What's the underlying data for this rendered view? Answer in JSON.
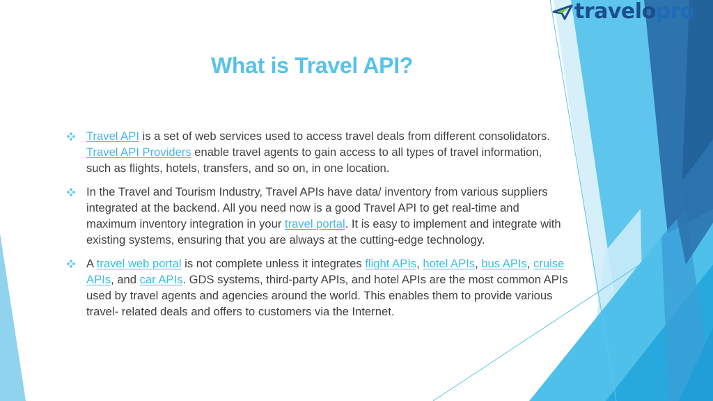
{
  "brand": {
    "logo_text_main": "travelo",
    "logo_text_accent": "pro",
    "colors": {
      "logo_dark": "#1a4e8c",
      "logo_green": "#7ac142",
      "title": "#56c3ea",
      "link": "#45b9e0",
      "body_text": "#404040",
      "shape_light": "#8fd3ef",
      "shape_mid": "#56c3ea",
      "shape_bright": "#2bb0e0",
      "shape_dark": "#2a6aa3",
      "shape_navy": "#23639b"
    }
  },
  "slide": {
    "title": "What is Travel API?",
    "bullet_icon": "four-diamond-bullet-icon",
    "bullets": [
      {
        "segments": [
          {
            "type": "link",
            "text": "Travel API"
          },
          {
            "type": "text",
            "text": " is a set of web services used to access travel deals from different consolidators. "
          },
          {
            "type": "link",
            "text": "Travel API Providers"
          },
          {
            "type": "text",
            "text": " enable travel agents to gain access to all types of travel information, such as flights, hotels, transfers, and so on, in one location."
          }
        ]
      },
      {
        "segments": [
          {
            "type": "text",
            "text": "In the Travel and Tourism Industry, Travel APIs have data/ inventory from various suppliers integrated at the backend. All you need now is a good Travel API to get real-time and maximum inventory integration in your "
          },
          {
            "type": "link",
            "text": "travel portal"
          },
          {
            "type": "text",
            "text": ". It is easy to implement and integrate with existing systems, ensuring that you are always at the cutting-edge technology."
          }
        ]
      },
      {
        "segments": [
          {
            "type": "text",
            "text": "A "
          },
          {
            "type": "link",
            "text": "travel web portal"
          },
          {
            "type": "text",
            "text": " is not complete unless it integrates "
          },
          {
            "type": "link",
            "text": "flight APIs"
          },
          {
            "type": "text",
            "text": ", "
          },
          {
            "type": "link",
            "text": "hotel APIs"
          },
          {
            "type": "text",
            "text": ", "
          },
          {
            "type": "link",
            "text": "bus APIs"
          },
          {
            "type": "text",
            "text": ", "
          },
          {
            "type": "link",
            "text": "cruise APIs"
          },
          {
            "type": "text",
            "text": ", and "
          },
          {
            "type": "link",
            "text": "car APIs"
          },
          {
            "type": "text",
            "text": ". GDS systems, third-party APIs, and hotel APIs are the most common APIs used by travel agents and agencies around the world. This enables them to provide various travel- related deals and offers to customers via the Internet."
          }
        ]
      }
    ]
  }
}
